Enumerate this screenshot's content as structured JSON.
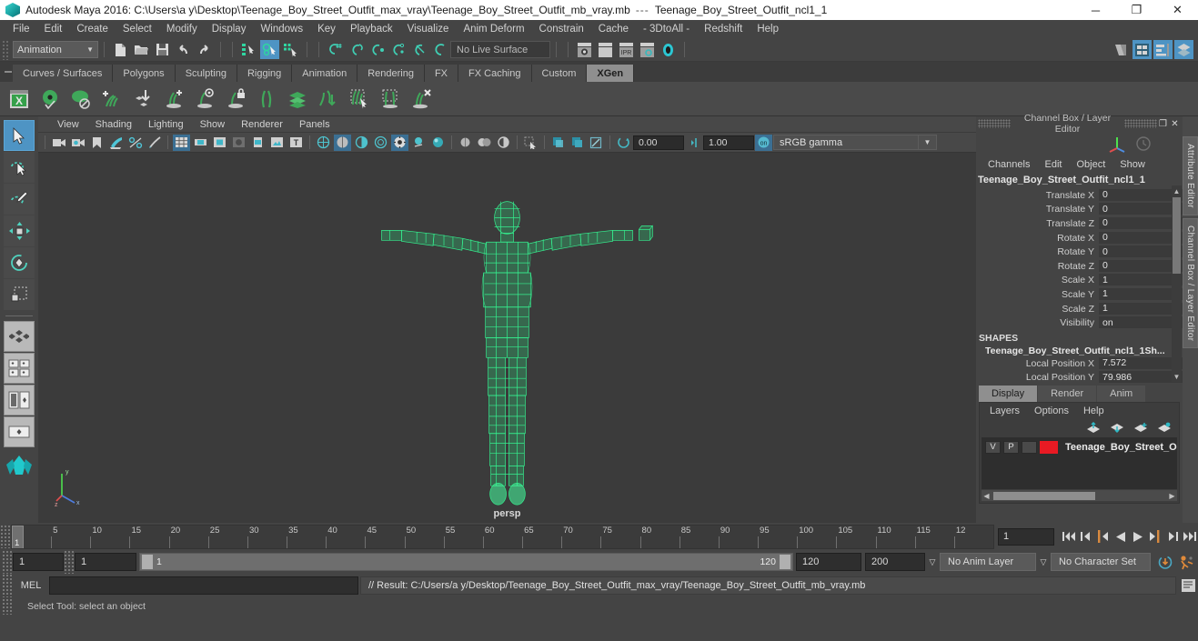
{
  "titlebar": {
    "app_title": "Autodesk Maya 2016: C:\\Users\\a y\\Desktop\\Teenage_Boy_Street_Outfit_max_vray\\Teenage_Boy_Street_Outfit_mb_vray.mb",
    "separator": "---",
    "object_title": "Teenage_Boy_Street_Outfit_ncl1_1",
    "minimize": "─",
    "maximize": "❐",
    "close": "✕"
  },
  "menubar": {
    "items": [
      "File",
      "Edit",
      "Create",
      "Select",
      "Modify",
      "Display",
      "Windows",
      "Key",
      "Playback",
      "Visualize",
      "Anim Deform",
      "Constrain",
      "Cache",
      "- 3DtoAll -",
      "Redshift",
      "Help"
    ]
  },
  "statusline": {
    "mode": "Animation",
    "caret": "▼",
    "live_surface": "No Live Surface"
  },
  "shelf": {
    "tabs": [
      "Curves / Surfaces",
      "Polygons",
      "Sculpting",
      "Rigging",
      "Animation",
      "Rendering",
      "FX",
      "FX Caching",
      "Custom",
      "XGen"
    ],
    "active_tab": "XGen",
    "icon_names": [
      "xgen-editor",
      "xgen-preview",
      "xgen-disable-preview",
      "xgen-add-description",
      "xgen-import-preset",
      "xgen-add-guide",
      "xgen-select-guide",
      "xgen-lock-guide",
      "xgen-comb-guide",
      "xgen-layers",
      "xgen-convert-guide",
      "xgen-region-select",
      "xgen-region-box",
      "xgen-delete-guide"
    ]
  },
  "viewport": {
    "menu": [
      "View",
      "Shading",
      "Lighting",
      "Show",
      "Renderer",
      "Panels"
    ],
    "exposure_value": "0.00",
    "gamma_value": "1.00",
    "color_profile": "sRGB gamma",
    "profile_caret": "▼",
    "camera_label": "persp",
    "axis_labels": {
      "y": "y",
      "x": "x",
      "z": "z"
    }
  },
  "toolbox": {
    "items": [
      {
        "name": "select-tool",
        "selected": true
      },
      {
        "name": "lasso-select-tool",
        "selected": false
      },
      {
        "name": "paint-select-tool",
        "selected": false
      },
      {
        "name": "move-tool",
        "selected": false
      },
      {
        "name": "rotate-tool",
        "selected": false
      },
      {
        "name": "scale-tool",
        "selected": false
      },
      {
        "name": "last-tool-used",
        "selected": false
      },
      {
        "name": "layout-four-view",
        "selected": false
      },
      {
        "name": "layout-persp-outliner",
        "selected": false
      },
      {
        "name": "layout-persp-graph",
        "selected": false
      },
      {
        "name": "layout-single-persp",
        "selected": false
      }
    ]
  },
  "channelbox": {
    "panel_title": "Channel Box / Layer Editor",
    "undock_icon": "❐",
    "close_icon": "✕",
    "menus": [
      "Channels",
      "Edit",
      "Object",
      "Show"
    ],
    "object_name": "Teenage_Boy_Street_Outfit_ncl1_1",
    "channels": [
      {
        "label": "Translate X",
        "value": "0"
      },
      {
        "label": "Translate Y",
        "value": "0"
      },
      {
        "label": "Translate Z",
        "value": "0"
      },
      {
        "label": "Rotate X",
        "value": "0"
      },
      {
        "label": "Rotate Y",
        "value": "0"
      },
      {
        "label": "Rotate Z",
        "value": "0"
      },
      {
        "label": "Scale X",
        "value": "1"
      },
      {
        "label": "Scale Y",
        "value": "1"
      },
      {
        "label": "Scale Z",
        "value": "1"
      },
      {
        "label": "Visibility",
        "value": "on"
      }
    ],
    "shapes_header": "SHAPES",
    "shape_name": "Teenage_Boy_Street_Outfit_ncl1_1Sh...",
    "shape_channels": [
      {
        "label": "Local Position X",
        "value": "7.572"
      },
      {
        "label": "Local Position Y",
        "value": "79.986"
      }
    ],
    "scroll_up": "▲",
    "scroll_down": "▼"
  },
  "right_tabs": [
    "Attribute Editor",
    "Channel Box / Layer Editor"
  ],
  "layer_editor": {
    "tabs": [
      "Display",
      "Render",
      "Anim"
    ],
    "active_tab": "Display",
    "menus": [
      "Layers",
      "Options",
      "Help"
    ],
    "icon_names": [
      "move-layer-up-icon",
      "move-layer-down-icon",
      "new-layer-icon",
      "new-layer-from-selected-icon"
    ],
    "layers": [
      {
        "visibility": "V",
        "playback": "P",
        "shading": "",
        "color": "#e81a23",
        "name": "Teenage_Boy_Street_Out"
      }
    ],
    "scroll_left": "◀",
    "scroll_right": "▶"
  },
  "timeline": {
    "ticks": [
      "5",
      "10",
      "15",
      "20",
      "25",
      "30",
      "35",
      "40",
      "45",
      "50",
      "55",
      "60",
      "65",
      "70",
      "75",
      "80",
      "85",
      "90",
      "95",
      "100",
      "105",
      "110",
      "115",
      "12"
    ],
    "tick_start": 5,
    "tick_step": 5,
    "current_frame": "1",
    "range_min": 1,
    "range_max": 120
  },
  "playback": {
    "frame_field": "1",
    "buttons": [
      {
        "name": "go-to-start-button",
        "glyph": "❘◀◀"
      },
      {
        "name": "step-back-key-button",
        "glyph": "❘◀"
      },
      {
        "name": "step-back-frame-button",
        "glyph": "❘◀"
      },
      {
        "name": "play-backwards-button",
        "glyph": "◀"
      },
      {
        "name": "play-forwards-button",
        "glyph": "▶"
      },
      {
        "name": "step-forward-frame-button",
        "glyph": "▶❘"
      },
      {
        "name": "step-forward-key-button",
        "glyph": "▶❘"
      },
      {
        "name": "go-to-end-button",
        "glyph": "▶▶❘"
      }
    ]
  },
  "range_slider": {
    "anim_start": "1",
    "range_start": "1",
    "bar_start_label": "1",
    "bar_end_label": "120",
    "range_end": "120",
    "anim_end": "200",
    "anim_layer": "No Anim Layer",
    "character_set": "No Character Set",
    "caret": "▽",
    "icon_names": [
      "auto-keyframe-icon",
      "animation-preferences-icon"
    ]
  },
  "command_line": {
    "mel_label": "MEL",
    "input_value": "",
    "result_text": "// Result: C:/Users/a y/Desktop/Teenage_Boy_Street_Outfit_max_vray/Teenage_Boy_Street_Outfit_mb_vray.mb",
    "script_editor_icon": "script-editor-icon"
  },
  "help_line": {
    "text": "Select Tool: select an object"
  }
}
